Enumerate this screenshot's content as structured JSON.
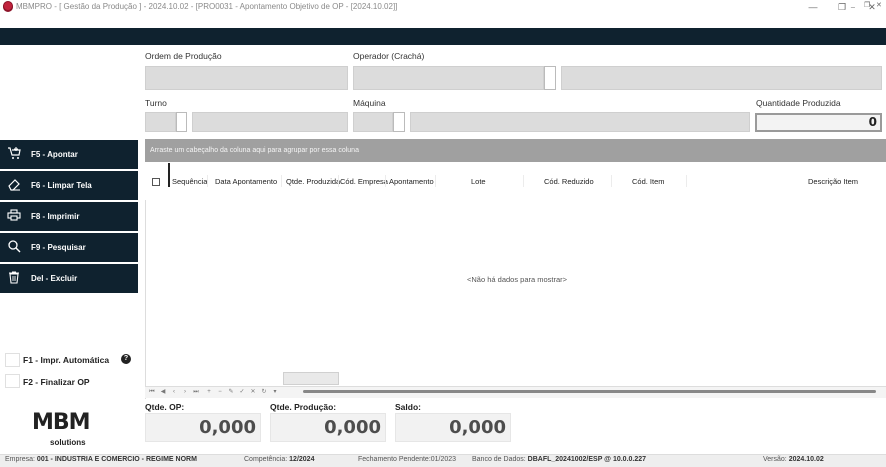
{
  "window": {
    "title": "MBMPRO - [ Gestão da Produção ] - 2024.10.02 - [PRO0031 - Apontamento Objetivo de OP - [2024.10.02]]",
    "brand_color": "#c0233d",
    "dark_color": "#0f222f"
  },
  "form": {
    "ordem_label": "Ordem de Produção",
    "operador_label": "Operador (Crachá)",
    "turno_label": "Turno",
    "maquina_label": "Máquina",
    "qtd_produzida_label": "Quantidade Produzida",
    "qtd_produzida_value": "0"
  },
  "sidebar": {
    "buttons": [
      {
        "label": "F5 - Apontar",
        "icon": "cart-add-icon"
      },
      {
        "label": "F6 - Limpar Tela",
        "icon": "eraser-icon"
      },
      {
        "label": "F8 - Imprimir",
        "icon": "printer-icon"
      },
      {
        "label": "F9 - Pesquisar",
        "icon": "search-icon"
      },
      {
        "label": "Del - Excluir",
        "icon": "trash-icon"
      }
    ],
    "options": [
      {
        "label": "F1 - Impr. Automática"
      },
      {
        "label": "F2 - Finalizar OP"
      }
    ],
    "help_glyph": "?"
  },
  "grid": {
    "group_panel_text": "Arraste um cabeçalho da coluna aqui para agrupar por essa coluna",
    "columns": [
      "Sequência",
      "Data Apontamento",
      "Qtde. Produzida",
      "Cód. Empresa",
      "Apontamento",
      "Lote",
      "Cód. Reduzido",
      "Cód. Item",
      "Descrição Item"
    ],
    "empty_text": "<Não há dados para mostrar>"
  },
  "totals": {
    "qtde_op_label": "Qtde. OP:",
    "qtde_op_value": "0,000",
    "qtde_producao_label": "Qtde. Produção:",
    "qtde_producao_value": "0,000",
    "saldo_label": "Saldo:",
    "saldo_value": "0,000"
  },
  "logo": {
    "mark": "MBM",
    "sub": "solutions"
  },
  "status": {
    "empresa_label": "Empresa:",
    "empresa_value": "001 - INDUSTRIA E COMERCIO - REGIME NORM",
    "competencia_label": "Competência:",
    "competencia_value": "12/2024",
    "fechamento": "Fechamento Pendente:01/2023",
    "banco_label": "Banco de Dados:",
    "banco_value": "DBAFL_20241002/ESP @ 10.0.0.227",
    "versao_label": "Versão:",
    "versao_value": "2024.10.02"
  }
}
